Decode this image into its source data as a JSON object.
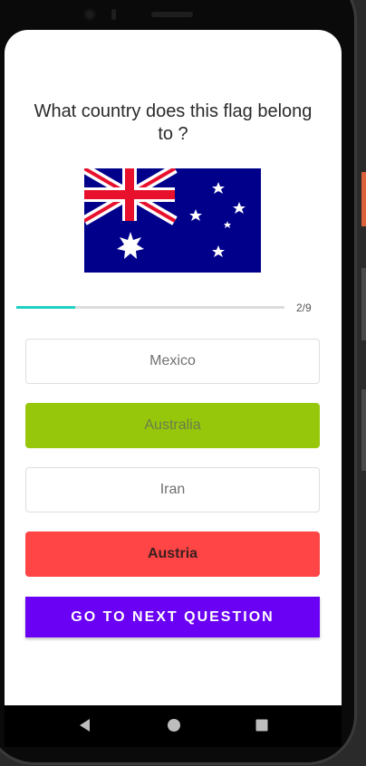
{
  "quiz": {
    "question": "What country does this flag belong to ?",
    "flag_icon": "australia-flag",
    "progress": {
      "current": 2,
      "total": 9,
      "label": "2/9",
      "fraction": 0.22
    },
    "options": [
      {
        "label": "Mexico",
        "state": "neutral"
      },
      {
        "label": "Australia",
        "state": "correct"
      },
      {
        "label": "Iran",
        "state": "neutral"
      },
      {
        "label": "Austria",
        "state": "wrong"
      }
    ],
    "next_button": "GO TO NEXT QUESTION"
  },
  "colors": {
    "correct": "#96c70b",
    "wrong": "#ff4545",
    "primary_button": "#6a00f4",
    "progress": "#1fd0c3"
  },
  "navbar": {
    "icons": [
      "back-icon",
      "home-icon",
      "recents-icon"
    ]
  }
}
